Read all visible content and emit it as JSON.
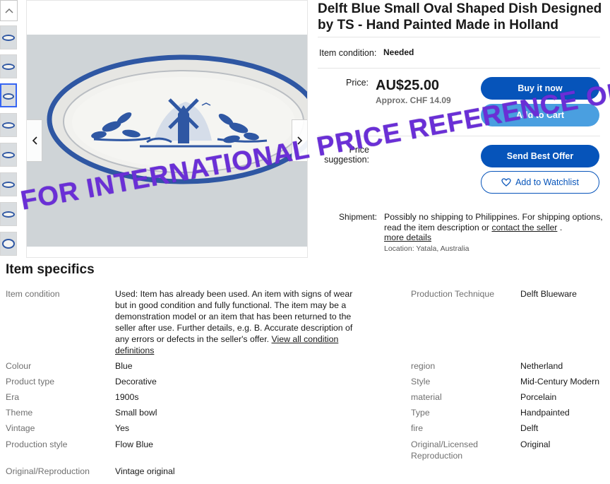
{
  "listing": {
    "title": "Delft Blue Small Oval Shaped Dish Designed by TS - Hand Painted Made in Holland",
    "condition_label": "Item condition:",
    "condition_value": "Needed",
    "price_label": "Price:",
    "price_value": "AU$25.00",
    "price_approx": "Approx. CHF 14.09",
    "suggestion_label": "Price suggestion:",
    "buttons": {
      "buy_now": "Buy it now",
      "add_to_cart": "Add to Cart",
      "best_offer": "Send Best Offer",
      "watchlist": "Add to Watchlist"
    },
    "shipping_label": "Shipment:",
    "shipping_text": "Possibly no shipping to Philippines. For shipping options, read the item description or",
    "shipping_link": "contact the seller",
    "shipping_after": ".",
    "more_details": "more details",
    "location": "Location: Yatala, Australia"
  },
  "watermark": "FOR INTERNATIONAL PRICE REFERENCE ONLY",
  "specifics": {
    "title": "Item specifics",
    "condition_key": "Item condition",
    "condition_value": "Used: Item has already been used. An item with signs of wear but in good condition and fully functional. The item may be a demonstration model or an item that has been returned to the seller after use. Further details, e.g. B. Accurate description of any errors or defects in the seller's offer.",
    "condition_link": "View all condition definitions",
    "left": [
      {
        "key": "Colour",
        "value": "Blue"
      },
      {
        "key": "Product type",
        "value": "Decorative"
      },
      {
        "key": "Era",
        "value": "1900s"
      },
      {
        "key": "Theme",
        "value": "Small bowl"
      },
      {
        "key": "Vintage",
        "value": "Yes"
      },
      {
        "key": "Production style",
        "value": "Flow Blue"
      },
      {
        "key": "Original/Reproduction",
        "value": "Vintage original"
      }
    ],
    "right": [
      {
        "key": "Production Technique",
        "value": "Delft Blueware"
      },
      {
        "key": "region",
        "value": "Netherland"
      },
      {
        "key": "Style",
        "value": "Mid-Century Modern"
      },
      {
        "key": "material",
        "value": "Porcelain"
      },
      {
        "key": "Type",
        "value": "Handpainted"
      },
      {
        "key": "fire",
        "value": "Delft"
      },
      {
        "key": "Original/Licensed Reproduction",
        "value": "Original"
      }
    ]
  },
  "colors": {
    "primary_button": "#0654ba",
    "secondary_button": "#4a9fe0",
    "watermark": "#6a2fd6",
    "delft_blue": "#2f57a3"
  },
  "icons": [
    "chevron-up-icon",
    "chevron-left-icon",
    "chevron-right-icon",
    "heart-icon"
  ]
}
